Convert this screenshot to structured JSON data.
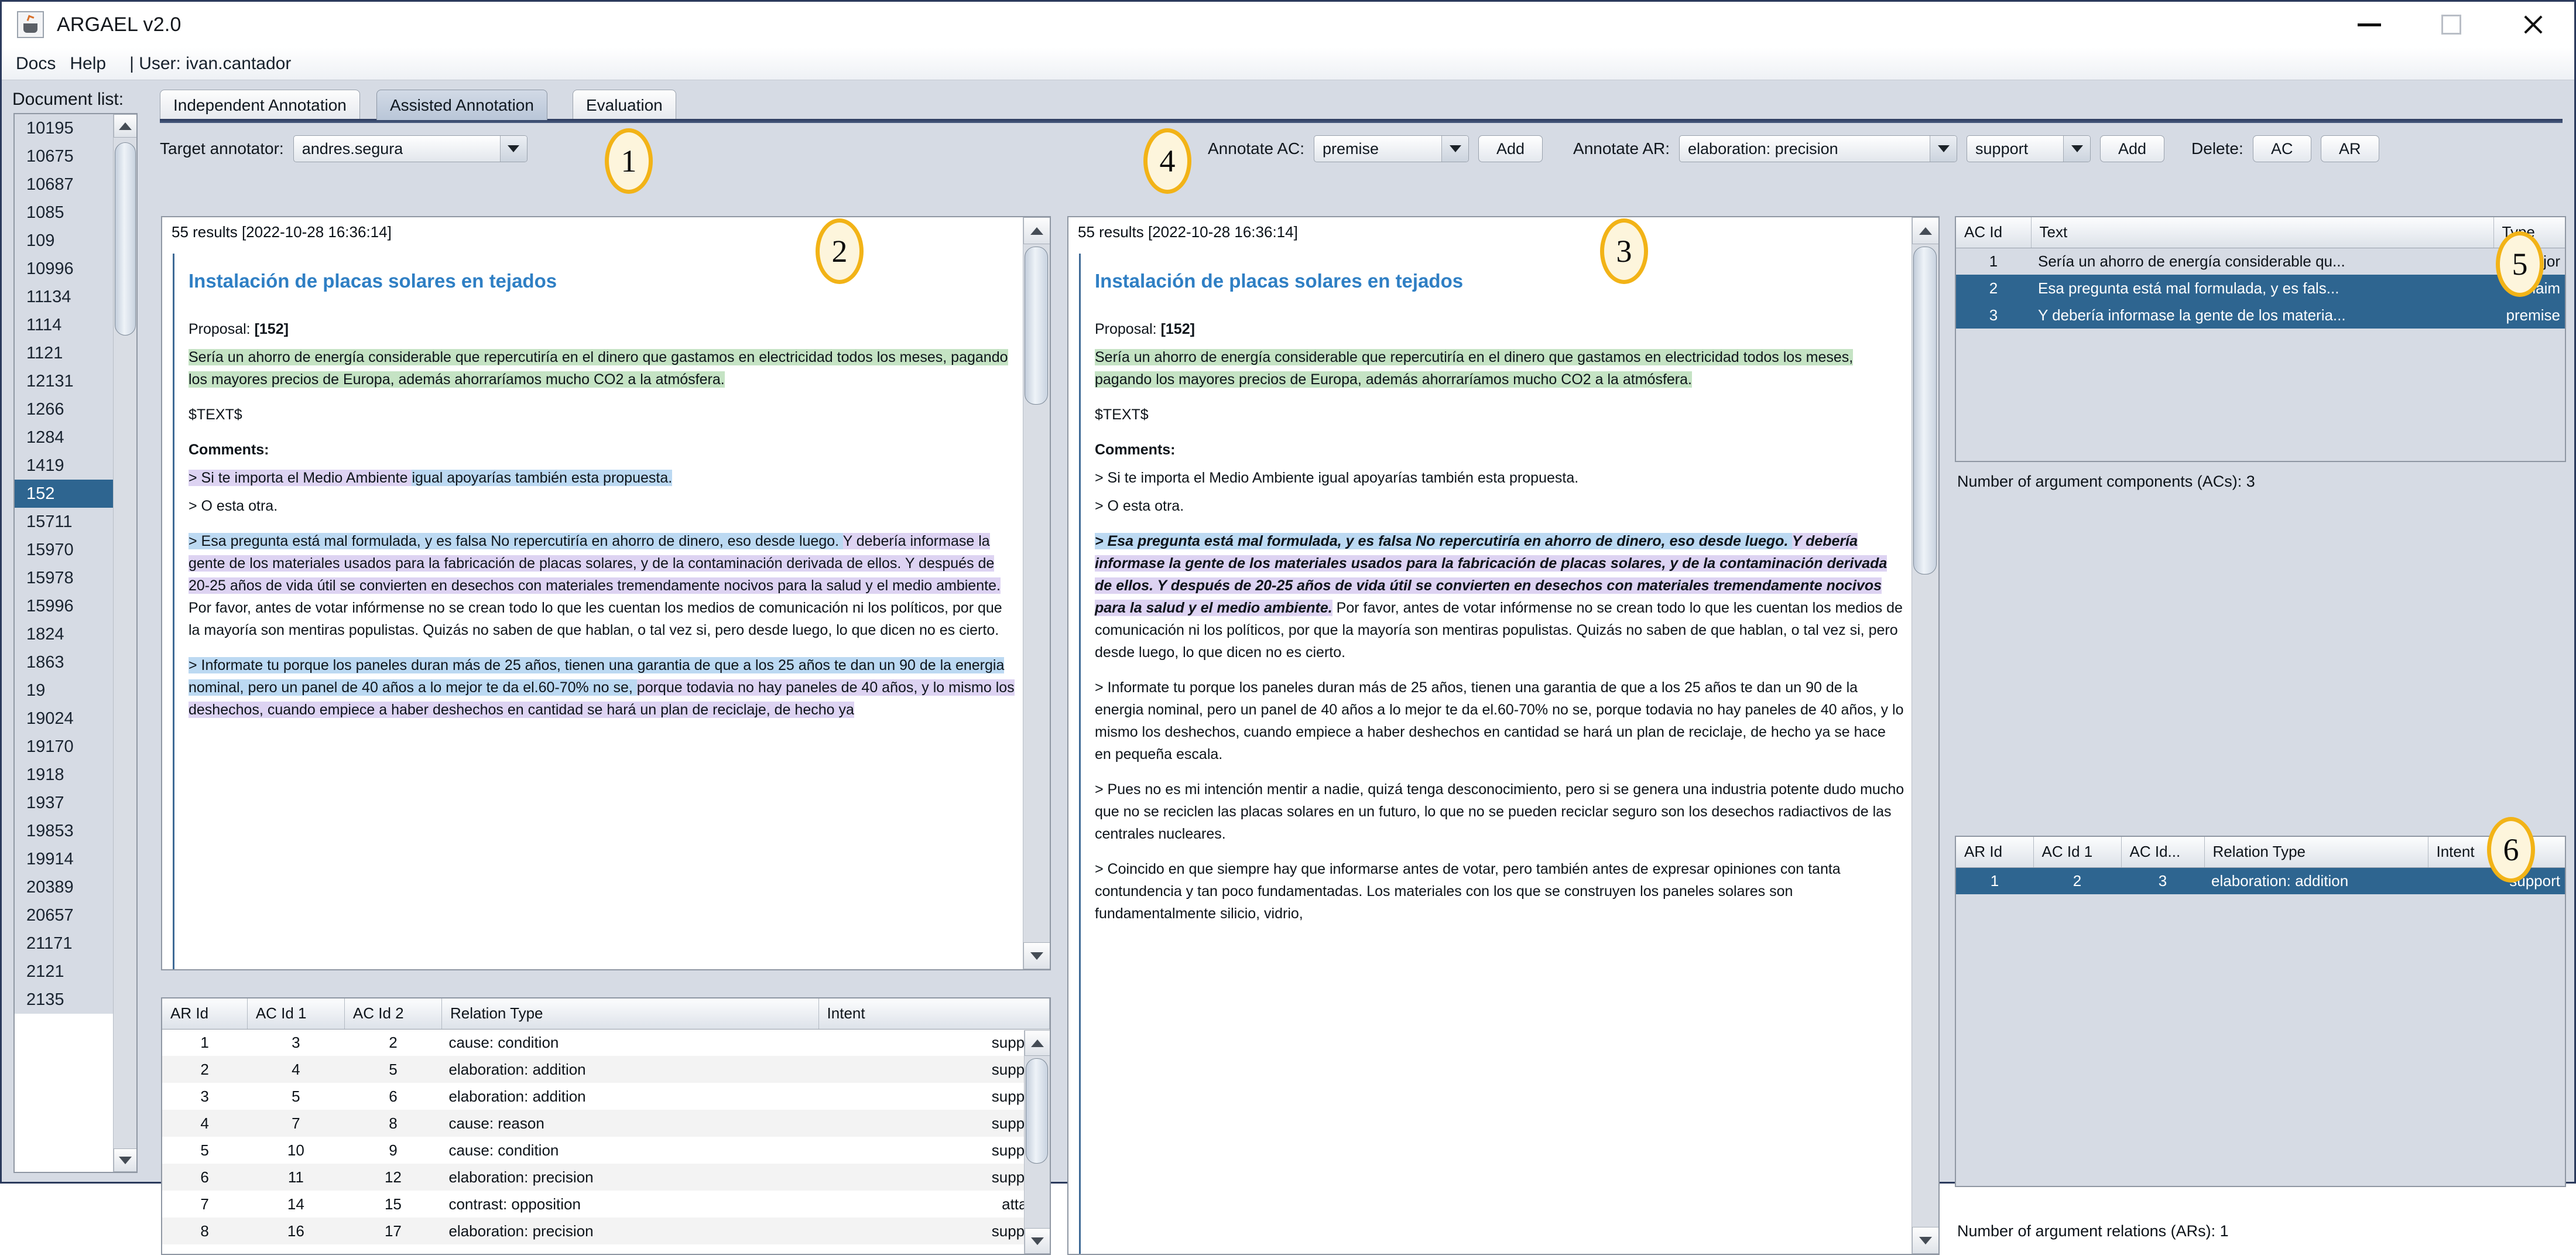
{
  "window": {
    "title": "ARGAEL v2.0",
    "app_icon": "java-cup-icon",
    "minimize": "minimize-icon",
    "maximize": "maximize-icon",
    "close": "close-icon"
  },
  "menubar": {
    "docs": "Docs",
    "help": "Help",
    "user": "| User: ivan.cantador"
  },
  "document_list": {
    "label": "Document list:",
    "selected": "152",
    "items": [
      "10195",
      "10675",
      "10687",
      "1085",
      "109",
      "10996",
      "11134",
      "1114",
      "1121",
      "12131",
      "1266",
      "1284",
      "1419",
      "152",
      "15711",
      "15970",
      "15978",
      "15996",
      "1824",
      "1863",
      "19",
      "19024",
      "19170",
      "1918",
      "1937",
      "19853",
      "19914",
      "20389",
      "20657",
      "21171",
      "2121",
      "2135"
    ]
  },
  "tabs": [
    {
      "label": "Independent Annotation",
      "active": false
    },
    {
      "label": "Assisted Annotation",
      "active": true
    },
    {
      "label": "Evaluation",
      "active": false
    }
  ],
  "toolbar": {
    "target_annotator_label": "Target annotator:",
    "target_annotator_value": "andres.segura",
    "annotate_ac_label": "Annotate AC:",
    "annotate_ac_value": "premise",
    "add_ac_label": "Add",
    "annotate_ar_label": "Annotate AR:",
    "annotate_ar_value": "elaboration: precision",
    "annotate_ar_intent_value": "support",
    "add_ar_label": "Add",
    "delete_label": "Delete:",
    "delete_ac_label": "AC",
    "delete_ar_label": "AR"
  },
  "callouts": {
    "one": "1",
    "two": "2",
    "three": "3",
    "four": "4",
    "five": "5",
    "six": "6"
  },
  "left_document": {
    "results": "55 results [2022-10-28 16:36:14]",
    "title": "Instalación de placas solares en tejados",
    "proposal_label": "Proposal:",
    "proposal_id": "[152]",
    "proposal_text": "Sería un ahorro de energía considerable que repercutiría en el dinero que gastamos en electricidad todos los meses, pagando los mayores precios de Europa, además ahorraríamos mucho CO2 a la atmósfera.",
    "text_placeholder": "$TEXT$",
    "comments_label": "Comments:",
    "c1_purple": "> Si te importa el Medio Ambiente ",
    "c1_blue": "igual apoyarías también esta propuesta.",
    "c2": "> O esta otra.",
    "c3_blue": "> Esa pregunta está mal formulada, y es falsa No repercutiría en ahorro de dinero, eso desde luego. ",
    "c3_purple": "Y debería informase la gente de los materiales usados para la fabricación de placas solares, y de la contaminación derivada de ellos. Y después de 20-25 años de vida útil se convierten en desechos con materiales tremendamente nocivos para la salud y el medio ambiente.",
    "c3_plain": " Por favor, antes de votar infórmense no se crean todo lo que les cuentan los medios de comunicación ni los políticos, por que la mayoría son mentiras populistas. Quizás no saben de que hablan, o tal vez si, pero desde luego, lo que dicen no es cierto.",
    "c4_blue": "> Informate tu porque los paneles duran más de 25 años, tienen una garantia de que a los 25 años te dan un 90 de la energia nominal, pero un panel de 40 años a lo mejor te da el.60-70% no se, ",
    "c4_purple": "porque todavia no hay paneles de 40 años, y lo mismo los deshechos, cuando empiece a haber deshechos en cantidad se hará un plan de reciclaje, de hecho ya"
  },
  "right_document": {
    "results": "55 results [2022-10-28 16:36:14]",
    "title": "Instalación de placas solares en tejados",
    "proposal_label": "Proposal:",
    "proposal_id": "[152]",
    "proposal_text": "Sería un ahorro de energía considerable que repercutiría en el dinero que gastamos en electricidad todos los meses, pagando los mayores precios de Europa, además ahorraríamos mucho CO2 a la atmósfera.",
    "text_placeholder": "$TEXT$",
    "comments_label": "Comments:",
    "c1": "> Si te importa el Medio Ambiente igual apoyarías también esta propuesta.",
    "c2": "> O esta otra.",
    "c3_blue": "> Esa pregunta está mal formulada, y es falsa No repercutiría en ahorro de dinero, eso desde luego. ",
    "c3_purple": "Y debería informase la gente de los materiales usados para la fabricación de placas solares, y de la contaminación derivada de ellos. Y después de 20-25 años de vida útil se convierten en desechos con materiales tremendamente nocivos para la salud y el medio ambiente.",
    "c3_plain": " Por favor, antes de votar infórmense no se crean todo lo que les cuentan los medios de comunicación ni los políticos, por que la mayoría son mentiras populistas. Quizás no saben de que hablan, o tal vez si, pero desde luego, lo que dicen no es cierto.",
    "c4": "> Informate tu porque los paneles duran más de 25 años, tienen una garantia de que a los 25 años te dan un 90 de la energia nominal, pero un panel de 40 años a lo mejor te da el.60-70% no se, porque todavia no hay paneles de 40 años, y lo mismo los deshechos, cuando empiece a haber deshechos en cantidad se hará un plan de reciclaje, de hecho ya se hace en pequeña escala.",
    "c5": "> Pues no es mi intención mentir a nadie, quizá tenga desconocimiento, pero si se genera una industria potente dudo mucho que no se reciclen las placas solares en un futuro, lo que no se pueden reciclar seguro son los desechos radiactivos de las centrales nucleares.",
    "c6": "> Coincido en que siempre hay que informarse antes de votar, pero también antes de expresar opiniones con tanta contundencia y tan poco fundamentadas. Los materiales con los que se construyen los paneles solares son fundamentalmente silicio, vidrio,"
  },
  "ar_table_left": {
    "columns": [
      "AR Id",
      "AC Id 1",
      "AC Id 2",
      "Relation Type",
      "Intent"
    ],
    "rows": [
      [
        "1",
        "3",
        "2",
        "cause: condition",
        "support"
      ],
      [
        "2",
        "4",
        "5",
        "elaboration: addition",
        "support"
      ],
      [
        "3",
        "5",
        "6",
        "elaboration: addition",
        "support"
      ],
      [
        "4",
        "7",
        "8",
        "cause: reason",
        "support"
      ],
      [
        "5",
        "10",
        "9",
        "cause: condition",
        "support"
      ],
      [
        "6",
        "11",
        "12",
        "elaboration: precision",
        "support"
      ],
      [
        "7",
        "14",
        "15",
        "contrast: opposition",
        "attack"
      ],
      [
        "8",
        "16",
        "17",
        "elaboration: precision",
        "support"
      ]
    ]
  },
  "ac_table": {
    "columns": [
      "AC Id",
      "Text",
      "Type"
    ],
    "rows": [
      {
        "id": "1",
        "text": "Sería un ahorro de energía considerable qu...",
        "type": "major",
        "selected": false
      },
      {
        "id": "2",
        "text": "Esa pregunta está mal formulada, y es fals...",
        "type": "claim",
        "selected": true
      },
      {
        "id": "3",
        "text": "Y debería informase la gente de los materia...",
        "type": "premise",
        "selected": true
      }
    ],
    "count_label": "Number of argument components (ACs): 3"
  },
  "ar_table_right": {
    "columns": [
      "AR Id",
      "AC Id 1",
      "AC Id...",
      "Relation Type",
      "Intent"
    ],
    "rows": [
      {
        "ar_id": "1",
        "ac1": "2",
        "ac2": "3",
        "relation": "elaboration: addition",
        "intent": "support",
        "selected": true
      }
    ],
    "count_label": "Number of argument relations (ARs): 1"
  },
  "colors": {
    "selection": "#2e6590",
    "highlight_green": "#c5e3c4",
    "highlight_blue": "#bcd9f2",
    "highlight_purple": "#ddd3f2",
    "callout_border": "#f2b317",
    "title_link": "#2f7fc4"
  }
}
